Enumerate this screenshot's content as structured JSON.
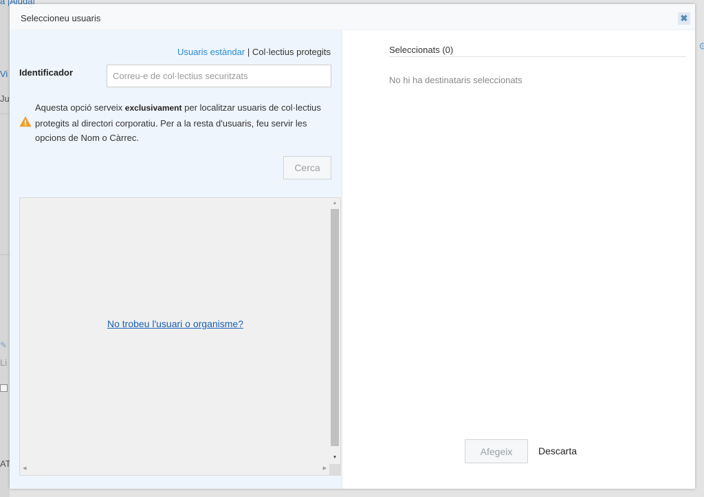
{
  "background": {
    "link_top": "a |Ajuda|",
    "frag_vi": "Vi",
    "frag_ju": "Ju",
    "frag_li": "Li",
    "frag_at": "AT",
    "gear_icon": "gear-icon",
    "clip_icon": "paperclip-icon"
  },
  "modal": {
    "title": "Seleccioneu usuaris",
    "close_icon": "close-icon",
    "close_glyph": "✖",
    "left": {
      "mode_standard": "Usuaris estàndar",
      "mode_separator": " | ",
      "mode_protected": "Col·lectius protegits",
      "identifier_label": "Identificador",
      "identifier_placeholder": "Correu-e de col·lectius securitzats",
      "warning_icon": "warning-icon",
      "warning_prefix": "Aquesta opció serveix ",
      "warning_bold": "exclusivament",
      "warning_suffix": " per localitzar usuaris de col·lectius protegits al directori corporatiu. Per a la resta d'usuaris, feu servir les opcions de Nom o Càrrec.",
      "search_button": "Cerca",
      "not_found_link": "No trobeu l'usuari o organisme?"
    },
    "right": {
      "selected_header": "Seleccionats (0)",
      "empty_text": "No hi ha destinataris seleccionats",
      "add_button": "Afegeix",
      "discard_button": "Descarta"
    },
    "colors": {
      "accent_link": "#2a8ad4",
      "left_pane_bg": "#eef5fc",
      "warning": "#f0a030"
    }
  }
}
